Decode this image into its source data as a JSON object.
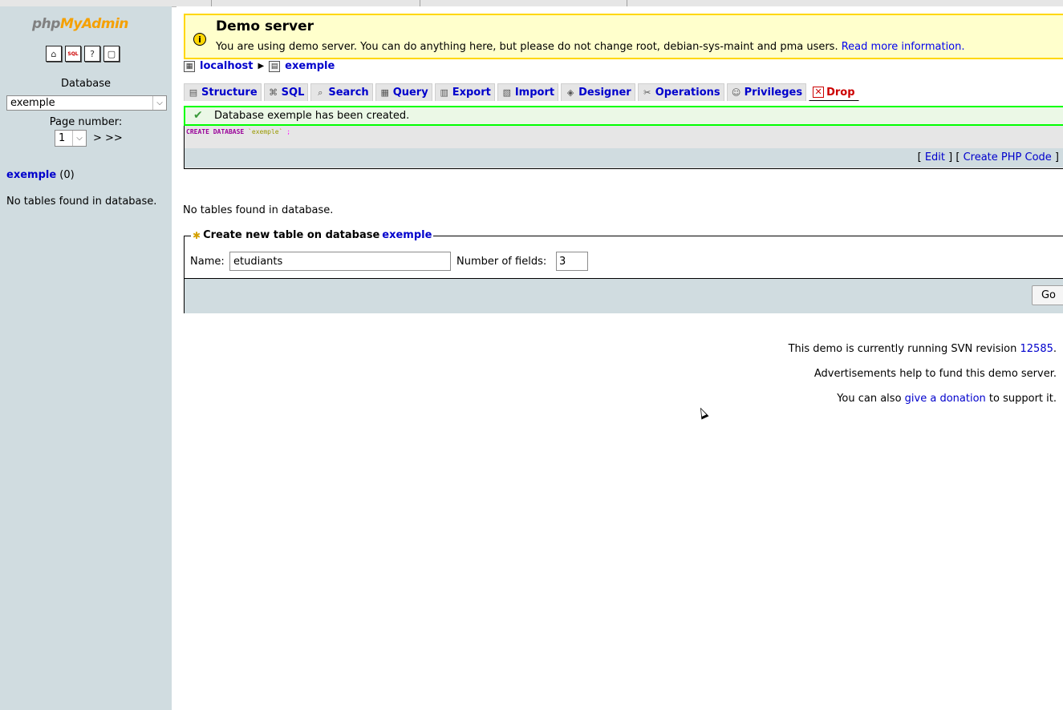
{
  "nav": {
    "logo": {
      "php": "php",
      "my": "My",
      "admin": "Admin"
    },
    "icons": [
      "home-icon",
      "sql-window-icon",
      "query-help-icon",
      "docs-icon"
    ],
    "icon_glyphs": [
      "⌂",
      "SQL",
      "?",
      "▢"
    ],
    "database_label": "Database",
    "database_selected": "exemple",
    "page_number_label": "Page number:",
    "page_number_value": "1",
    "page_next": "> >>",
    "db_link": "exemple",
    "db_table_count": "(0)",
    "no_tables": "No tables found in database."
  },
  "demo": {
    "title": "Demo server",
    "message": "You are using demo server. You can do anything here, but please do not change root, debian-sys-maint and pma users.",
    "link": "Read more information."
  },
  "breadcrumb": {
    "server": "localhost",
    "database": "exemple"
  },
  "tabs": [
    {
      "label": "Structure",
      "icon": "structure-icon",
      "glyph": "▤"
    },
    {
      "label": "SQL",
      "icon": "sql-icon",
      "glyph": "⌘"
    },
    {
      "label": "Search",
      "icon": "search-icon",
      "glyph": "⌕"
    },
    {
      "label": "Query",
      "icon": "query-icon",
      "glyph": "▦"
    },
    {
      "label": "Export",
      "icon": "export-icon",
      "glyph": "▥"
    },
    {
      "label": "Import",
      "icon": "import-icon",
      "glyph": "▧"
    },
    {
      "label": "Designer",
      "icon": "designer-icon",
      "glyph": "◈"
    },
    {
      "label": "Operations",
      "icon": "operations-icon",
      "glyph": "✂"
    },
    {
      "label": "Privileges",
      "icon": "privileges-icon",
      "glyph": "☺"
    },
    {
      "label": "Drop",
      "icon": "drop-icon",
      "glyph": "✕"
    }
  ],
  "success": {
    "message": "Database exemple has been created."
  },
  "sql": {
    "keyword": "CREATE DATABASE",
    "identifier": "`exemple`",
    "terminator": ";",
    "edit_link": "Edit",
    "php_link": "Create PHP Code",
    "bracket_open": "[ ",
    "bracket_mid": " ] [ ",
    "bracket_close": " ]"
  },
  "main": {
    "no_tables": "No tables found in database."
  },
  "create_table": {
    "legend_prefix": "Create new table on database",
    "legend_db": "exemple",
    "name_label": "Name:",
    "name_value": "etudiants",
    "fields_label": "Number of fields:",
    "fields_value": "3",
    "go_label": "Go"
  },
  "footer": {
    "svn_prefix": "This demo is currently running SVN revision",
    "svn_revision": "12585",
    "svn_suffix": ".",
    "ads": "Advertisements help to fund this demo server.",
    "donate_prefix": "You can also",
    "donate_link": "give a donation",
    "donate_suffix": "to support it."
  }
}
